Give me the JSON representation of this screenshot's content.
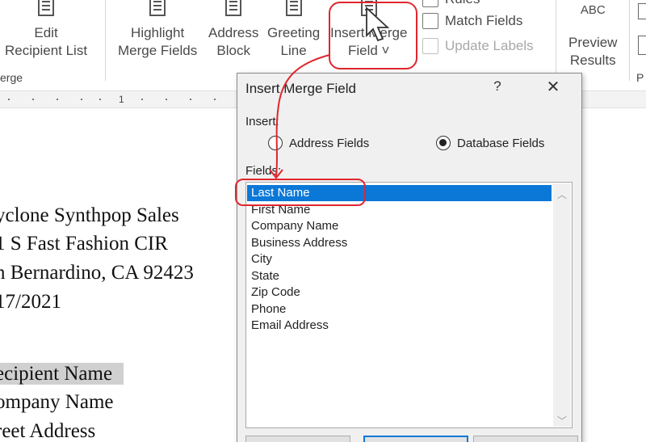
{
  "ribbon": {
    "edit_recipient_list": {
      "line1": "Edit",
      "line2": "Recipient List"
    },
    "group_label": "erge",
    "highlight_merge_fields": {
      "line1": "Highlight",
      "line2": "Merge Fields"
    },
    "address_block": {
      "line1": "Address",
      "line2": "Block"
    },
    "greeting_line": {
      "line1": "Greeting",
      "line2": "Line"
    },
    "insert_merge_field": {
      "line1": "Insert Merge",
      "line2": "Field",
      "chevron": "˅"
    },
    "rules": "Rules",
    "match_fields": "Match Fields",
    "update_labels": "Update Labels",
    "preview_results": {
      "abc": "ABC",
      "line1": "Preview",
      "line2": "Results"
    },
    "partial_label": "P"
  },
  "ruler": {
    "number": "1"
  },
  "document": {
    "lines": [
      "yclone Synthpop Sales",
      "1 S Fast Fashion CIR",
      "n Bernardino, CA 92423",
      "17/2021"
    ],
    "merge_lines": [
      "ecipient Name",
      "ompany Name",
      "reet Address"
    ]
  },
  "dialog": {
    "title": "Insert Merge Field",
    "help": "?",
    "close": "✕",
    "insert_label": "Insert:",
    "address_fields": "Address Fields",
    "database_fields": "Database Fields",
    "selected_radio": "database_fields",
    "fields_label": "Fields:",
    "fields": [
      "Last Name",
      "First Name",
      "Company Name",
      "Business Address",
      "City",
      "State",
      "Zip Code",
      "Phone",
      "Email Address"
    ],
    "selected_field": "Last Name"
  },
  "colors": {
    "selection": "#0b78d7",
    "annotation": "#e0262e",
    "highlight": "#d0d0d0"
  }
}
